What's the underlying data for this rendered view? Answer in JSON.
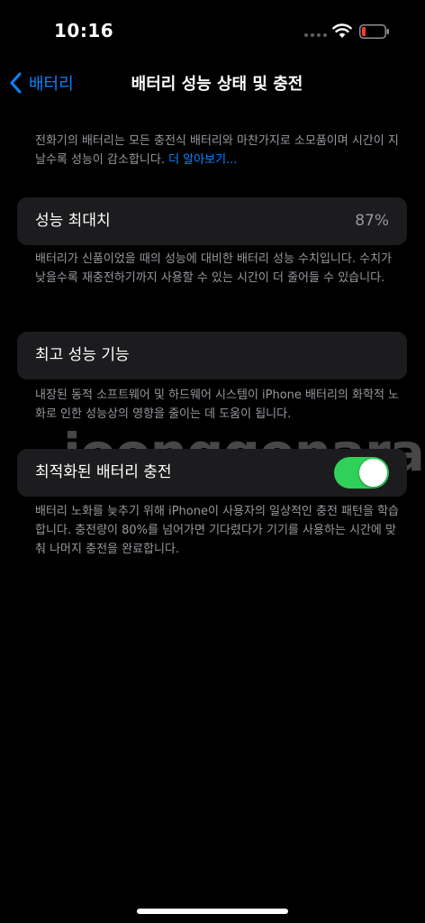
{
  "status_bar": {
    "time": "10:16"
  },
  "nav": {
    "back_label": "배터리",
    "title": "배터리 성능 상태 및 충전"
  },
  "intro": {
    "text": "전화기의 배터리는 모든 충전식 배터리와 마찬가지로 소모품이며 시간이 지날수록 성능이 감소합니다. ",
    "link": "더 알아보기..."
  },
  "max_capacity": {
    "label": "성능 최대치",
    "value": "87%",
    "description": "배터리가 신품이었을 때의 성능에 대비한 배터리 성능 수치입니다. 수치가 낮을수록 재충전하기까지 사용할 수 있는 시간이 더 줄어들 수 있습니다."
  },
  "peak_performance": {
    "label": "최고 성능 기능",
    "description": "내장된 동적 소프트웨어 및 하드웨어 시스템이 iPhone 배터리의 화학적 노화로 인한 성능상의 영향을 줄이는 데 도움이 됩니다."
  },
  "optimized_charging": {
    "label": "최적화된 배터리 충전",
    "enabled": true,
    "description": "배터리 노화를 늦추기 위해 iPhone이 사용자의 일상적인 충전 패턴을 학습합니다. 충전량이 80%를 넘어가면 기다렸다가 기기를 사용하는 시간에 맞춰 나머지 충전을 완료합니다."
  },
  "watermark": "joonggonara",
  "colors": {
    "accent": "#0a84ff",
    "toggle_on": "#30d158",
    "battery_low": "#ff3b30",
    "card_bg": "#1c1c1e",
    "secondary_text": "#98989f"
  },
  "icons": {
    "back": "chevron-left-icon",
    "wifi": "wifi-icon",
    "battery": "battery-low-icon",
    "signal": "cellular-signal-icon"
  }
}
